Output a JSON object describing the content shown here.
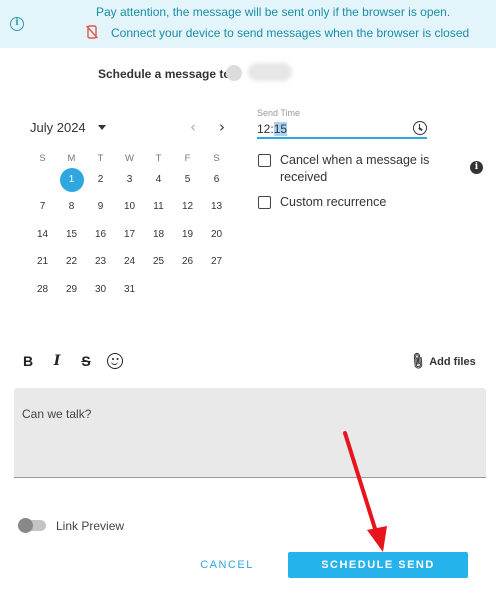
{
  "banner": {
    "line1": "Pay attention, the message will be sent only if the browser is open.",
    "line2": "Connect your device to send messages when the browser is closed"
  },
  "header": {
    "schedule_to": "Schedule a message to"
  },
  "calendar": {
    "month_label": "July 2024",
    "weekdays": [
      "S",
      "M",
      "T",
      "W",
      "T",
      "F",
      "S"
    ],
    "weeks": [
      [
        "",
        "1",
        "2",
        "3",
        "4",
        "5",
        "6"
      ],
      [
        "7",
        "8",
        "9",
        "10",
        "11",
        "12",
        "13"
      ],
      [
        "14",
        "15",
        "16",
        "17",
        "18",
        "19",
        "20"
      ],
      [
        "21",
        "22",
        "23",
        "24",
        "25",
        "26",
        "27"
      ],
      [
        "28",
        "29",
        "30",
        "31",
        "",
        "",
        ""
      ]
    ],
    "selected_day": "1"
  },
  "send_time": {
    "label": "Send Time",
    "hour": "12:",
    "minute": "15"
  },
  "options": {
    "cancel_when_received": "Cancel when a message is received",
    "custom_recurrence": "Custom recurrence"
  },
  "toolbar": {
    "bold": "B",
    "italic": "I",
    "strike": "S",
    "add_files": "Add files"
  },
  "message": {
    "text": "Can we talk?"
  },
  "link_preview": {
    "label": "Link Preview",
    "enabled": false
  },
  "actions": {
    "cancel": "CANCEL",
    "schedule_send": "SCHEDULE SEND"
  },
  "colors": {
    "accent": "#26b2ea",
    "banner_bg": "#e3f4fb",
    "arrow": "#e8141c"
  }
}
